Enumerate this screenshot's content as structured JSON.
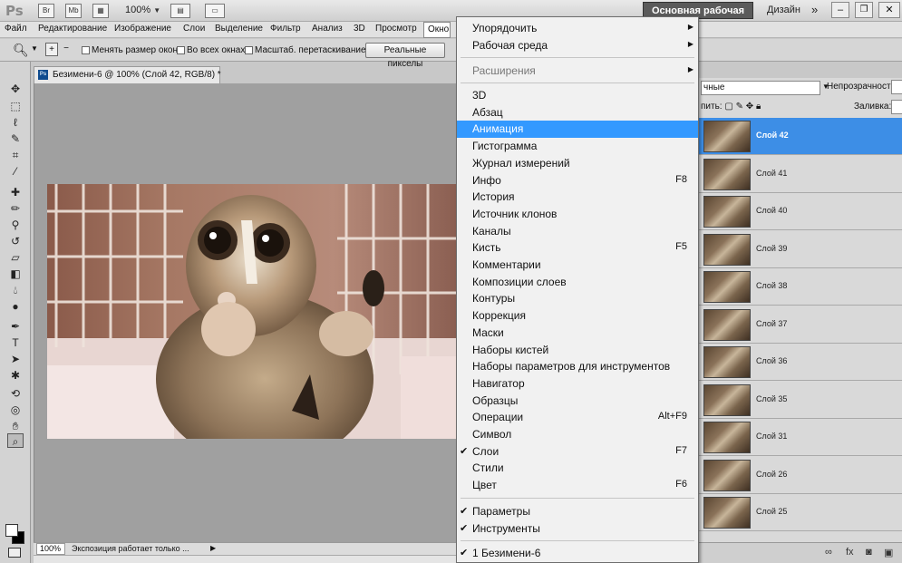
{
  "appbar": {
    "logo": "Ps",
    "icon_br": "Br",
    "icon_mb": "Mb",
    "zoom": "100%",
    "workspace_active": "Основная рабочая среда",
    "workspace_design": "Дизайн",
    "more": "»"
  },
  "menubar": [
    "Файл",
    "Редактирование",
    "Изображение",
    "Слои",
    "Выделение",
    "Фильтр",
    "Анализ",
    "3D",
    "Просмотр",
    "Окно"
  ],
  "options": {
    "resize_windows": "Менять размер окон",
    "all_windows": "Во всех окнах",
    "scrubby_zoom": "Масштаб. перетаскиванием",
    "actual_pixels": "Реальные пикселы"
  },
  "document": {
    "title": "Безимени-6 @ 100% (Слой 42, RGB/8) *",
    "zoom": "100%",
    "status": "Экспозиция работает только ..."
  },
  "window_menu": {
    "items": [
      {
        "label": "Упорядочить",
        "submenu": true
      },
      {
        "label": "Рабочая среда",
        "submenu": true
      },
      {
        "sep": true
      },
      {
        "label": "Расширения",
        "submenu": true,
        "disabled": true
      },
      {
        "sep": true
      },
      {
        "label": "3D"
      },
      {
        "label": "Абзац"
      },
      {
        "label": "Анимация",
        "highlighted": true
      },
      {
        "label": "Гистограмма"
      },
      {
        "label": "Журнал измерений"
      },
      {
        "label": "Инфо",
        "shortcut": "F8"
      },
      {
        "label": "История"
      },
      {
        "label": "Источник клонов"
      },
      {
        "label": "Каналы"
      },
      {
        "label": "Кисть",
        "shortcut": "F5"
      },
      {
        "label": "Комментарии"
      },
      {
        "label": "Композиции слоев"
      },
      {
        "label": "Контуры"
      },
      {
        "label": "Коррекция"
      },
      {
        "label": "Маски"
      },
      {
        "label": "Наборы кистей"
      },
      {
        "label": "Наборы параметров для инструментов"
      },
      {
        "label": "Навигатор"
      },
      {
        "label": "Образцы"
      },
      {
        "label": "Операции",
        "shortcut": "Alt+F9"
      },
      {
        "label": "Символ"
      },
      {
        "label": "Слои",
        "shortcut": "F7",
        "checked": true
      },
      {
        "label": "Стили"
      },
      {
        "label": "Цвет",
        "shortcut": "F6"
      },
      {
        "sep": true
      },
      {
        "label": "Параметры",
        "checked": true
      },
      {
        "label": "Инструменты",
        "checked": true
      },
      {
        "sep": true
      },
      {
        "label": "1 Безимени-6",
        "checked": true
      }
    ]
  },
  "layers": {
    "blend_mode": "чные",
    "opacity_label": "Непрозрачность:",
    "lock_label": "пить:",
    "fill_label": "Заливка:",
    "rows": [
      {
        "name": "Слой 42",
        "selected": true
      },
      {
        "name": "Слой 41"
      },
      {
        "name": "Слой 40"
      },
      {
        "name": "Слой 39"
      },
      {
        "name": "Слой 38"
      },
      {
        "name": "Слой 37"
      },
      {
        "name": "Слой 36"
      },
      {
        "name": "Слой 35"
      },
      {
        "name": "Слой 31"
      },
      {
        "name": "Слой 26"
      },
      {
        "name": "Слой 25"
      }
    ]
  },
  "colors": {
    "highlight": "#3399ff",
    "layer_selected": "#3d8ee6",
    "workspace_button": "#5b5b5b"
  }
}
